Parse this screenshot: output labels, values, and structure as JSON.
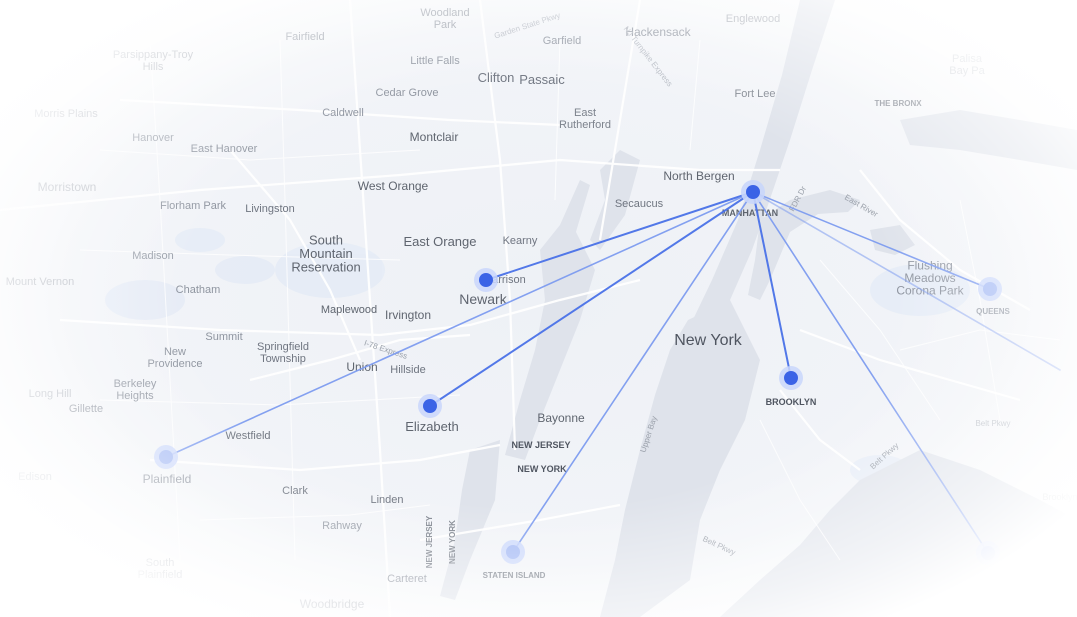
{
  "map": {
    "places": [
      {
        "name": "Woodland\nPark",
        "key": "woodland-park"
      },
      {
        "name": "Garden State Pkwy",
        "key": "garden-state-pkwy"
      },
      {
        "name": "Garfield",
        "key": "garfield"
      },
      {
        "name": "Hackensack",
        "key": "hackensack"
      },
      {
        "name": "Englewood",
        "key": "englewood"
      },
      {
        "name": "Fairfield",
        "key": "fairfield"
      },
      {
        "name": "Parsippany-Troy\nHills",
        "key": "parsippany"
      },
      {
        "name": "Little Falls",
        "key": "little-falls"
      },
      {
        "name": "Clifton",
        "key": "clifton"
      },
      {
        "name": "Passaic",
        "key": "passaic"
      },
      {
        "name": "NJ Turnpike Express",
        "key": "nj-tpk"
      },
      {
        "name": "Palisa\nBay Pa",
        "key": "pelham-bay"
      },
      {
        "name": "Cedar Grove",
        "key": "cedar-grove"
      },
      {
        "name": "Fort Lee",
        "key": "fort-lee"
      },
      {
        "name": "Morris Plains",
        "key": "morris-plains"
      },
      {
        "name": "Caldwell",
        "key": "caldwell"
      },
      {
        "name": "East\nRutherford",
        "key": "east-rutherford"
      },
      {
        "name": "THE BRONX",
        "key": "the-bronx"
      },
      {
        "name": "Hanover",
        "key": "hanover"
      },
      {
        "name": "Montclair",
        "key": "montclair"
      },
      {
        "name": "East Hanover",
        "key": "east-hanover"
      },
      {
        "name": "Morristown",
        "key": "morristown"
      },
      {
        "name": "West Orange",
        "key": "west-orange"
      },
      {
        "name": "North Bergen",
        "key": "north-bergen"
      },
      {
        "name": "FDR Dr",
        "key": "fdr-dr"
      },
      {
        "name": "East River",
        "key": "east-river"
      },
      {
        "name": "Florham Park",
        "key": "florham-park"
      },
      {
        "name": "Livingston",
        "key": "livingston"
      },
      {
        "name": "Secaucus",
        "key": "secaucus"
      },
      {
        "name": "MANHATTAN",
        "key": "manhattan"
      },
      {
        "name": "Madison",
        "key": "madison"
      },
      {
        "name": "South\nMountain\nReservation",
        "key": "south-mountain"
      },
      {
        "name": "East Orange",
        "key": "east-orange"
      },
      {
        "name": "Kearny",
        "key": "kearny"
      },
      {
        "name": "Flushing\nMeadows\nCorona Park",
        "key": "flushing-meadows"
      },
      {
        "name": "Harrison",
        "key": "harrison"
      },
      {
        "name": "Mount Vernon",
        "key": "mount-vernon"
      },
      {
        "name": "Chatham",
        "key": "chatham"
      },
      {
        "name": "Newark",
        "key": "newark"
      },
      {
        "name": "QUEENS",
        "key": "queens"
      },
      {
        "name": "Maplewood",
        "key": "maplewood"
      },
      {
        "name": "Irvington",
        "key": "irvington"
      },
      {
        "name": "Summit",
        "key": "summit"
      },
      {
        "name": "New York",
        "key": "new-york"
      },
      {
        "name": "I-78 Express",
        "key": "i78"
      },
      {
        "name": "Springfield\nTownship",
        "key": "springfield"
      },
      {
        "name": "New\nProvidence",
        "key": "new-providence"
      },
      {
        "name": "Union",
        "key": "union"
      },
      {
        "name": "Hillside",
        "key": "hillside"
      },
      {
        "name": "Berkeley\nHeights",
        "key": "berkeley-heights"
      },
      {
        "name": "Long Hill",
        "key": "long-hill"
      },
      {
        "name": "Gillette",
        "key": "gillette"
      },
      {
        "name": "BROOKLYN",
        "key": "brooklyn"
      },
      {
        "name": "Elizabeth",
        "key": "elizabeth"
      },
      {
        "name": "Bayonne",
        "key": "bayonne"
      },
      {
        "name": "Upper Bay",
        "key": "upper-bay"
      },
      {
        "name": "Belt Pkwy",
        "key": "belt-pkwy-east"
      },
      {
        "name": "Westfield",
        "key": "westfield"
      },
      {
        "name": "NEW JERSEY",
        "key": "nj-label"
      },
      {
        "name": "NEW YORK",
        "key": "ny-label"
      },
      {
        "name": "Belt Pkwy",
        "key": "belt-pkwy-diag"
      },
      {
        "name": "Plainfield",
        "key": "plainfield"
      },
      {
        "name": "Clark",
        "key": "clark"
      },
      {
        "name": "Linden",
        "key": "linden"
      },
      {
        "name": "Rahway",
        "key": "rahway"
      },
      {
        "name": "NEW JERSEY",
        "key": "nj-vertical"
      },
      {
        "name": "NEW YORK",
        "key": "ny-vertical"
      },
      {
        "name": "Belt Pkwy",
        "key": "belt-pkwy-south"
      },
      {
        "name": "STATEN ISLAND",
        "key": "staten-island"
      },
      {
        "name": "South\nPlainfield",
        "key": "south-plainfield"
      },
      {
        "name": "Carteret",
        "key": "carteret"
      },
      {
        "name": "Woodbridge",
        "key": "woodbridge"
      },
      {
        "name": "Edison",
        "key": "edison"
      },
      {
        "name": "Brooklyn",
        "key": "brooklyn-east"
      }
    ],
    "hub": {
      "name": "MANHATTAN"
    },
    "destinations": [
      {
        "key": "newark",
        "label": "Newark",
        "strength": "strong"
      },
      {
        "key": "elizabeth",
        "label": "Elizabeth",
        "strength": "strong"
      },
      {
        "key": "plainfield",
        "label": "Plainfield",
        "strength": "light"
      },
      {
        "key": "staten-island",
        "label": "STATEN ISLAND",
        "strength": "light"
      },
      {
        "key": "brooklyn",
        "label": "BROOKLYN",
        "strength": "strong"
      },
      {
        "key": "queens",
        "label": "QUEENS",
        "strength": "light"
      },
      {
        "key": "jamaica-bay",
        "label": "",
        "strength": "light"
      },
      {
        "key": "east-offscreen",
        "label": "",
        "strength": "light"
      }
    ],
    "colors": {
      "line_strong": "#4a72e8",
      "line_light": "#7e9cf0",
      "dot_strong": "#3b63e6",
      "dot_light": "#a9bdf5",
      "halo": "#c9d6fb",
      "water": "#e2e6ee",
      "land": "#f3f5f8",
      "road": "#ffffff",
      "park": "#e7eef8",
      "text": "#6f7580",
      "text_dark": "#4f5560"
    }
  }
}
